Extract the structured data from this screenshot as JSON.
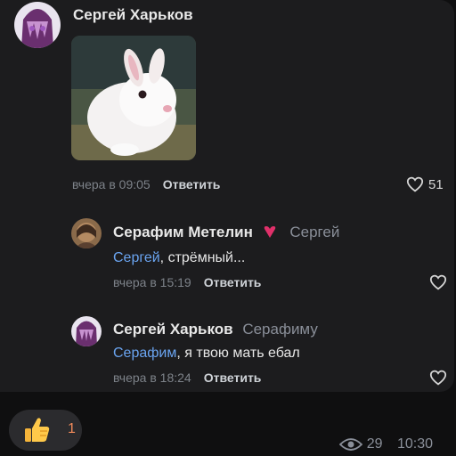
{
  "post": {
    "author": "Сергей Харьков",
    "time": "вчера в 09:05",
    "reply_label": "Ответить",
    "likes": "51"
  },
  "comments": [
    {
      "author": "Серафим Метелин",
      "reply_to": "Сергей",
      "mention": "Сергей",
      "text": ", стрёмный...",
      "time": "вчера в 15:19",
      "reply_label": "Ответить"
    },
    {
      "author": "Сергей Харьков",
      "reply_to": "Серафиму",
      "mention": "Серафим",
      "text": ", я твою мать ебал",
      "time": "вчера в 18:24",
      "reply_label": "Ответить"
    }
  ],
  "reaction": {
    "icon": "thumbs-up-icon",
    "count": "1"
  },
  "footer": {
    "views": "29",
    "time": "10:30"
  },
  "colors": {
    "mention": "#6aa4f0",
    "accent_heart": "#e0306a",
    "background": "#1c1c1e"
  }
}
